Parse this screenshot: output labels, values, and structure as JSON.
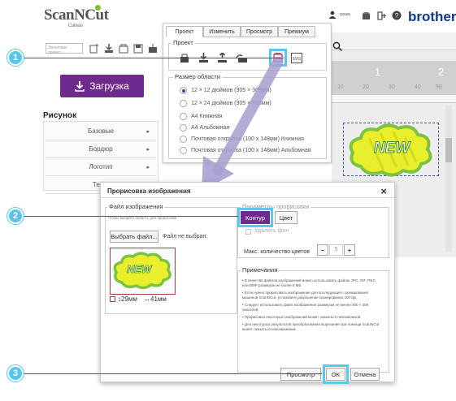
{
  "app": {
    "logo_text": "ScanNCut",
    "logo_sub": "Canvas",
    "brand": "brother",
    "user": "xxxxx"
  },
  "toolbar": {
    "template_placeholder": "Заголовок проект"
  },
  "sidebar": {
    "upload_label": "Загрузка",
    "section_title": "Рисунок",
    "categories": [
      "Базовые",
      "Бордюр",
      "Логотип",
      "Текст"
    ]
  },
  "menu": {
    "tabs": [
      "Проект",
      "Изменить",
      "Просмотр",
      "Премиум"
    ],
    "project_legend": "Проект",
    "area_legend": "Размер области",
    "options": [
      "12 × 12 дюймов (305 × 305мм)",
      "12 × 24 дюймов (305 × 610мм)",
      "A4 Книжная",
      "A4 Альбомная",
      "Почтовая открытка (100 x 148мм) Книжная",
      "Почтовая открытка (100 x 148мм) Альбомная"
    ]
  },
  "mat": {
    "ruler_top": [
      "1",
      "2"
    ],
    "ruler_bottom": [
      "10",
      "20",
      "30",
      "40",
      "50"
    ]
  },
  "dialog": {
    "title": "Прорисовка изображения",
    "close": "×",
    "file_legend": "Файл изображения",
    "file_hint": "Чтобы выбрать область для прорисовки.",
    "choose_file": "Выбрать файл...",
    "no_file": "Файл не выбран.",
    "height": "29мм",
    "width": "41мм",
    "trace_legend": "Параметры прорисовки",
    "mode_outline": "Контур",
    "mode_color": "Цвет",
    "remove_bg": "Удалить фон",
    "max_colors_label": "Макс. количество цветов",
    "max_colors_value": "5",
    "minus": "−",
    "plus": "+",
    "notes_legend": "Примечания",
    "notes": [
      "В качестве файлов изображений можно использовать файлы JPG, GIF, PNG или BMP размером не более 5 МБ.",
      "Если нужно прорисовать изображение для последующего сканирования машиной ScanNCut, установите разрешение сканирования 100 dpi.",
      "Следует использовать файл изображения размером не менее 300 × 300 пикселей.",
      "Прорисовка некоторых изображений может оказаться невозможной.",
      "Для некоторых результатов преобразования вырезание при помощи ScanNCut может оказаться невозможным."
    ],
    "preview": "Просмотр",
    "ok": "OK",
    "cancel": "Отмена"
  },
  "artwork": {
    "text": "NEW"
  },
  "callouts": [
    "1",
    "2",
    "3"
  ],
  "colors": {
    "accent": "#6f2a8e",
    "callout": "#56c6ea",
    "art_yellow": "#e9ef2a",
    "art_green": "#7cc243"
  }
}
